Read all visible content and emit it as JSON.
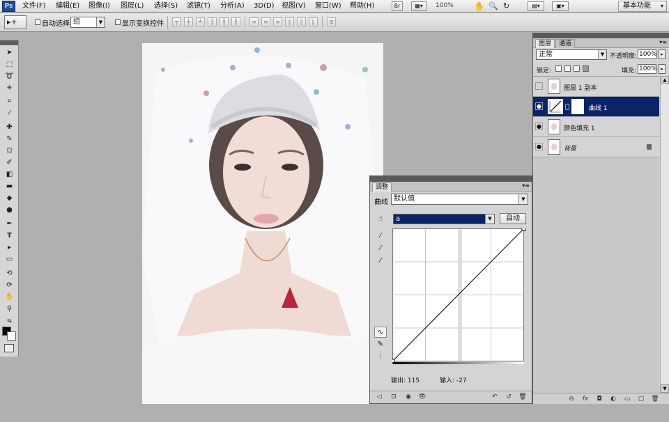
{
  "app": {
    "logo": "Ps",
    "zoom": "100%",
    "workspace": "基本功能"
  },
  "menu": {
    "items": [
      "文件(F)",
      "编辑(E)",
      "图像(I)",
      "图层(L)",
      "选择(S)",
      "滤镜(T)",
      "分析(A)",
      "3D(D)",
      "视图(V)",
      "窗口(W)",
      "帮助(H)"
    ],
    "bridge_label": "Br"
  },
  "options": {
    "tool_preset": "▸+",
    "auto_select_label": "自动选择:",
    "auto_select_value": "组",
    "show_transform_label": "显示变换控件"
  },
  "adjustments": {
    "tab": "调整",
    "curves_label": "曲线",
    "preset": "默认值",
    "channel": "a",
    "auto_button": "自动",
    "output_label": "输出: 115",
    "input_label": "输入: -27",
    "curve": {
      "input_range": [
        0,
        255
      ],
      "output_range": [
        0,
        255
      ],
      "points": [
        [
          0,
          0
        ],
        [
          255,
          255
        ]
      ]
    }
  },
  "layers": {
    "tabs": [
      "图层",
      "通道"
    ],
    "blend_mode": "正常",
    "opacity_label": "不透明度:",
    "opacity": "100%",
    "lock_label": "锁定:",
    "fill_label": "填充:",
    "fill": "100%",
    "items": [
      {
        "name": "图层 1 副本",
        "visible": false,
        "selected": false,
        "type": "pixel"
      },
      {
        "name": "曲线 1",
        "visible": true,
        "selected": true,
        "type": "adjustment"
      },
      {
        "name": "颜色填充 1",
        "visible": true,
        "selected": false,
        "type": "pixel"
      },
      {
        "name": "背景",
        "visible": true,
        "selected": false,
        "type": "background"
      }
    ]
  },
  "colors": {
    "accent": "#0a246a",
    "panel": "#d4d4d4",
    "canvas": "#b0b0b0",
    "panel_header": "#5a5a5a"
  }
}
